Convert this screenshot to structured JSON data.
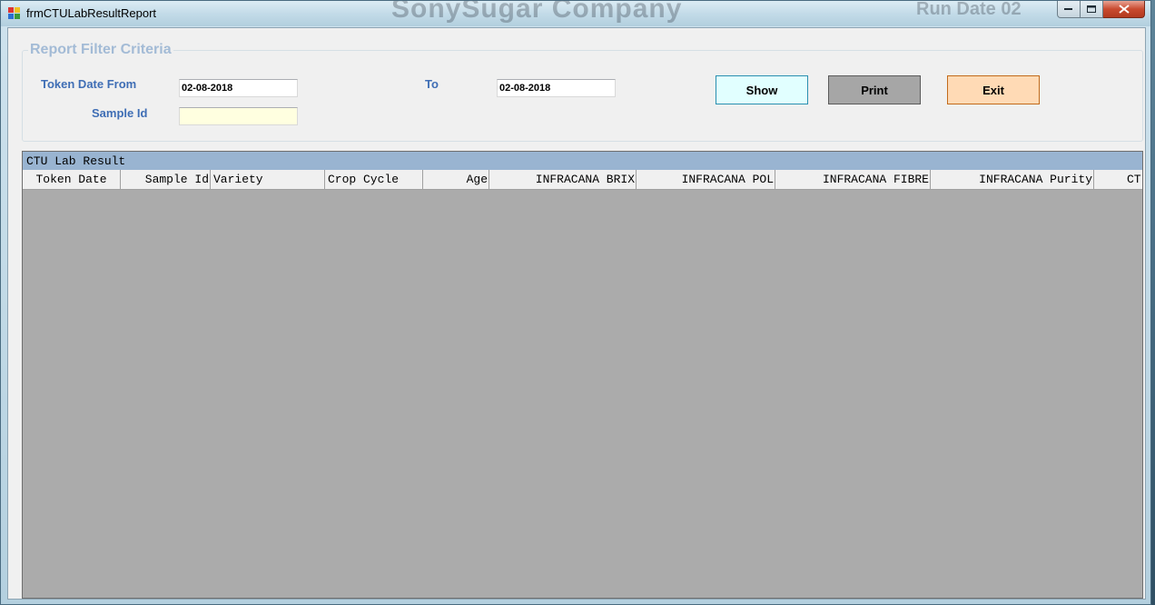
{
  "window": {
    "title": "frmCTULabResultReport",
    "background_text_1": "SonySugar Company",
    "background_text_2": "Run Date 02"
  },
  "filter": {
    "group_title": "Report Filter Criteria",
    "token_date_from_label": "Token Date From",
    "token_date_from_value": "02-08-2018",
    "to_label": "To",
    "to_value": "02-08-2018",
    "sample_id_label": "Sample Id",
    "sample_id_value": ""
  },
  "buttons": {
    "show": "Show",
    "print": "Print",
    "exit": "Exit"
  },
  "grid": {
    "caption": "CTU Lab Result",
    "columns": [
      "Token Date",
      "Sample Id",
      "Variety",
      "Crop Cycle",
      "Age",
      "INFRACANA BRIX",
      "INFRACANA POL",
      "INFRACANA FIBRE",
      "INFRACANA Purity",
      "CT"
    ],
    "rows": []
  },
  "colors": {
    "caption_bg": "#99b4d1",
    "show_bg": "#e1ffff",
    "print_bg": "#a6a6a6",
    "exit_bg": "#ffdab5",
    "label_color": "#3f6eb5",
    "grid_bg": "#ababab"
  }
}
